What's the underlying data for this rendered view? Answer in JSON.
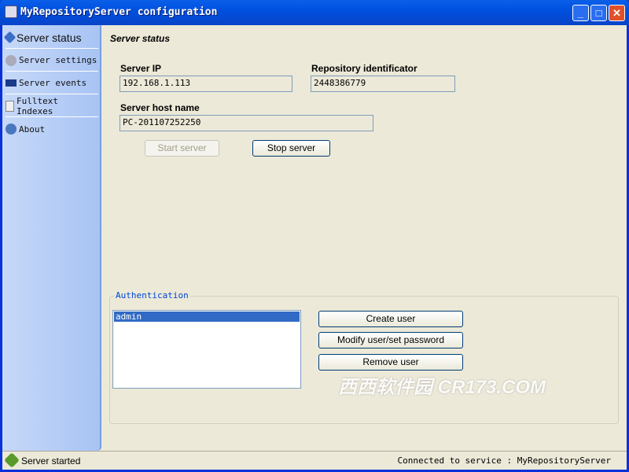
{
  "window": {
    "title": "MyRepositoryServer configuration",
    "minimize": "_",
    "maximize": "□",
    "close": "✕"
  },
  "sidebar": {
    "items": [
      {
        "label": "Server status",
        "icon": "info-diamond-icon"
      },
      {
        "label": "Server settings",
        "icon": "gear-icon"
      },
      {
        "label": "Server events",
        "icon": "flag-icon"
      },
      {
        "label": "Fulltext Indexes",
        "icon": "document-icon"
      },
      {
        "label": "About",
        "icon": "info-icon"
      }
    ]
  },
  "main": {
    "heading": "Server status",
    "server_ip_label": "Server IP",
    "server_ip": "192.168.1.113",
    "repo_id_label": "Repository identificator",
    "repo_id": "2448386779",
    "host_label": "Server host name",
    "host": "PC-201107252250",
    "start_button": "Start server",
    "stop_button": "Stop server"
  },
  "auth": {
    "legend": "Authentication",
    "users": [
      "admin"
    ],
    "create_button": "Create user",
    "modify_button": "Modify user/set password",
    "remove_button": "Remove user"
  },
  "watermark": "西西软件园 CR173.COM",
  "status": {
    "left": "Server started",
    "right": "Connected to service : MyRepositoryServer"
  }
}
